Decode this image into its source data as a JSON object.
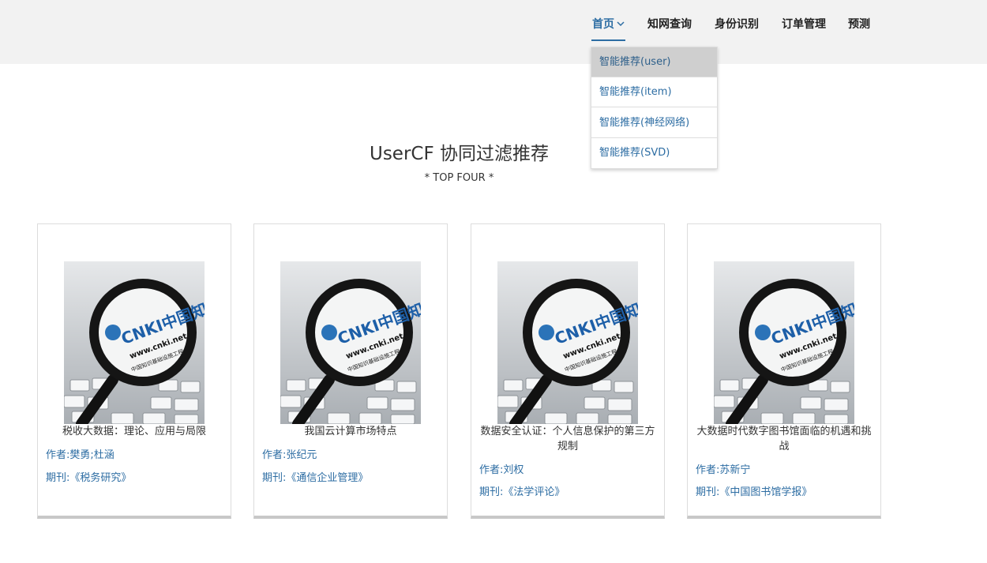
{
  "nav": {
    "items": [
      {
        "label": "首页"
      },
      {
        "label": "知网查询"
      },
      {
        "label": "身份识别"
      },
      {
        "label": "订单管理"
      },
      {
        "label": "预测"
      }
    ],
    "dropdown": [
      {
        "label": "智能推荐(user)"
      },
      {
        "label": "智能推荐(item)"
      },
      {
        "label": "智能推荐(神经网络)"
      },
      {
        "label": "智能推荐(SVD)"
      }
    ]
  },
  "page": {
    "title": "UserCF 协同过滤推荐",
    "subtitle": "* TOP FOUR *"
  },
  "cards": [
    {
      "title": "税收大数据：理论、应用与局限",
      "author": "作者:樊勇;杜涵",
      "journal": "期刊:《税务研究》"
    },
    {
      "title": "我国云计算市场特点",
      "author": "作者:张纪元",
      "journal": "期刊:《通信企业管理》"
    },
    {
      "title": "数据安全认证：个人信息保护的第三方规制",
      "author": "作者:刘权",
      "journal": "期刊:《法学评论》"
    },
    {
      "title": "大数据时代数字图书馆面临的机遇和挑战",
      "author": "作者:苏新宁",
      "journal": "期刊:《中国图书馆学报》"
    }
  ],
  "image": {
    "logo_text": "CNKI中国知网",
    "url_text": "www.cnki.net",
    "tagline": "中国知识基础设施工程"
  },
  "colors": {
    "accent": "#2d6da3",
    "topbar": "#f2f2f2",
    "dropdown_highlight": "#cfcfcf"
  }
}
